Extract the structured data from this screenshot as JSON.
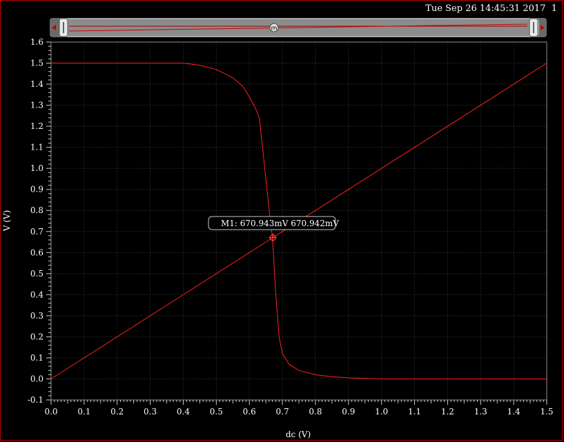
{
  "timestamp": "Tue Sep 26 14:45:31 2017  1",
  "scrollbar": {
    "marker_label": "m"
  },
  "marker": {
    "label": "M1: 670.943mV 670.942mV",
    "x": 0.670943,
    "y": 0.670942
  },
  "chart_data": {
    "type": "line",
    "xlabel": "dc (V)",
    "ylabel": "V (V)",
    "xlim": [
      0.0,
      1.5
    ],
    "ylim": [
      -0.1,
      1.6
    ],
    "x_ticks": [
      "0.0",
      "0.1",
      "0.2",
      "0.3",
      "0.4",
      "0.5",
      "0.6",
      "0.7",
      "0.8",
      "0.9",
      "1.0",
      "1.1",
      "1.2",
      "1.3",
      "1.4",
      "1.5"
    ],
    "y_ticks": [
      "-0.1",
      "0.0",
      "0.1",
      "0.2",
      "0.3",
      "0.4",
      "0.5",
      "0.6",
      "0.7",
      "0.8",
      "0.9",
      "1.0",
      "1.1",
      "1.2",
      "1.3",
      "1.4",
      "1.5",
      "1.6"
    ],
    "grid": true,
    "series": [
      {
        "color": "#ff2020",
        "x": [
          0.0,
          0.4,
          0.45,
          0.5,
          0.55,
          0.58,
          0.6,
          0.62,
          0.63,
          0.64,
          0.65,
          0.66,
          0.67,
          0.68,
          0.69,
          0.7,
          0.72,
          0.75,
          0.8,
          0.85,
          0.9,
          1.0,
          1.5
        ],
        "y": [
          1.5,
          1.5,
          1.49,
          1.47,
          1.43,
          1.39,
          1.34,
          1.28,
          1.24,
          1.1,
          0.95,
          0.8,
          0.671,
          0.4,
          0.2,
          0.12,
          0.07,
          0.04,
          0.02,
          0.01,
          0.005,
          0.0,
          0.0
        ]
      },
      {
        "color": "#ff2020",
        "x": [
          0.0,
          1.5
        ],
        "y": [
          0.0,
          1.5
        ]
      }
    ]
  }
}
